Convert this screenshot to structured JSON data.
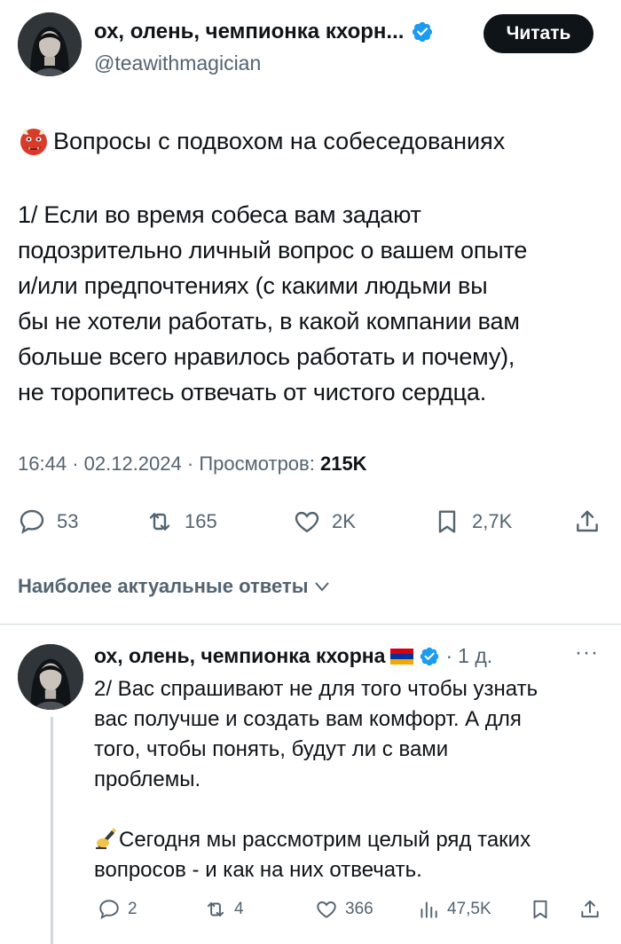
{
  "tweet": {
    "author_name": "ох, олень, чемпионка кхорн...",
    "handle": "@teawithmagician",
    "follow_label": "Читать",
    "title": "Вопросы с подвохом на собеседованиях",
    "body_lines": [
      "1/ Если во время собеса вам задают",
      "подозрительно личный вопрос о вашем опыте",
      "и/или предпочтениях (с какими людьми вы",
      "бы не хотели работать, в какой компании вам",
      "больше всего нравилось работать и почему),",
      "не торопитесь отвечать от чистого сердца."
    ],
    "meta": {
      "time": "16:44",
      "date": "02.12.2024",
      "views_label": "Просмотров:",
      "views_count": "215K"
    },
    "actions": {
      "replies": "53",
      "retweets": "165",
      "likes": "2K",
      "bookmarks": "2,7K"
    }
  },
  "replies_section": {
    "title": "Наиболее актуальные ответы"
  },
  "reply": {
    "author_name": "ох, олень, чемпионка кхорна",
    "time": "1 д.",
    "body_lines_1": [
      "2/ Вас спрашивают не для того чтобы узнать",
      "вас получше и создать вам комфорт. А для",
      "того, чтобы понять, будут ли с вами",
      "проблемы."
    ],
    "body_line_2a": "Сегодня мы рассмотрим целый ряд таких",
    "body_line_2b": "вопросов - и как на них отвечать.",
    "actions": {
      "replies": "2",
      "retweets": "4",
      "likes": "366",
      "views": "47,5K"
    }
  },
  "icons": {
    "title_emoji": "ogre-emoji",
    "reply_emoji": "writing-hand-emoji",
    "reply_flag": "armenia-flag-icon"
  },
  "colors": {
    "verified_blue": "#1d9bf0",
    "muted_text": "#536471",
    "divider": "#cfd9de",
    "follow_button": "#0f1419"
  }
}
